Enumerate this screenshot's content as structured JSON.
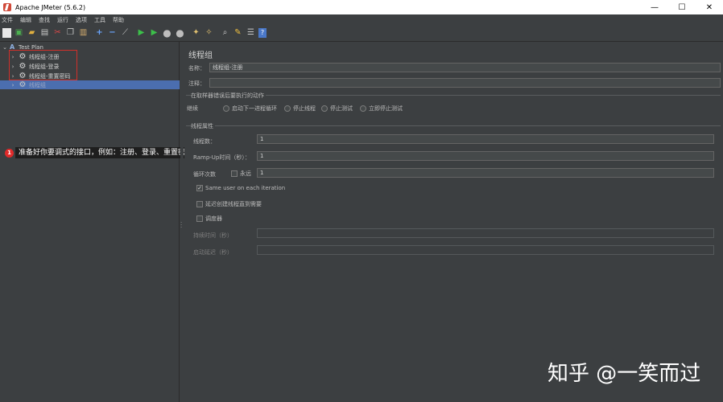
{
  "window": {
    "title": "Apache JMeter (5.6.2)",
    "controls": {
      "minimize": "—",
      "maximize": "☐",
      "close": "✕"
    }
  },
  "menu": [
    "文件",
    "编辑",
    "查找",
    "运行",
    "选项",
    "工具",
    "帮助"
  ],
  "toolbar_icons": [
    "new-icon",
    "templates-icon",
    "open-icon",
    "save-icon",
    "cut-icon",
    "copy-icon",
    "paste-icon",
    "expand-icon",
    "collapse-icon",
    "toggle-icon",
    "start-icon",
    "start-no-pause-icon",
    "stop-icon",
    "shutdown-icon",
    "clear-icon",
    "clear-all-icon",
    "search-icon",
    "reset-search-icon",
    "function-helper-icon",
    "help-icon"
  ],
  "tree": {
    "root": "Test Plan",
    "items": [
      "线程组-注册",
      "线程组-登录",
      "线程组-重置密码",
      "线程组"
    ],
    "selected_index": 3
  },
  "callout": {
    "badge": "1",
    "text": "准备好你要调式的接口，例如：注册、登录、重置密码"
  },
  "panel": {
    "heading": "线程组",
    "name_label": "名称：",
    "name_value": "线程组-注册",
    "comment_label": "注释：",
    "comment_value": "",
    "error_group_title": "在取样器错误后要执行的动作",
    "error_actions": [
      "继续",
      "启动下一进程循环",
      "停止线程",
      "停止测试",
      "立即停止测试"
    ],
    "props_title": "线程属性",
    "threads_label": "线程数：",
    "threads_value": "1",
    "rampup_label": "Ramp-Up时间（秒）：",
    "rampup_value": "1",
    "loop_label": "循环次数",
    "forever_label": "永远",
    "loop_value": "1",
    "same_user_label": "Same user on each iteration",
    "same_user_checked": true,
    "delay_label": "延迟创建线程直到需要",
    "scheduler_label": "调度器",
    "duration_label": "持续时间（秒）",
    "startup_delay_label": "启动延迟（秒）"
  },
  "watermark": "知乎 @一笑而过",
  "colors": {
    "background": "#3c3f41",
    "selection": "#4b6eaf",
    "annotation": "#d0302a",
    "callout_badge": "#e02a2a"
  }
}
